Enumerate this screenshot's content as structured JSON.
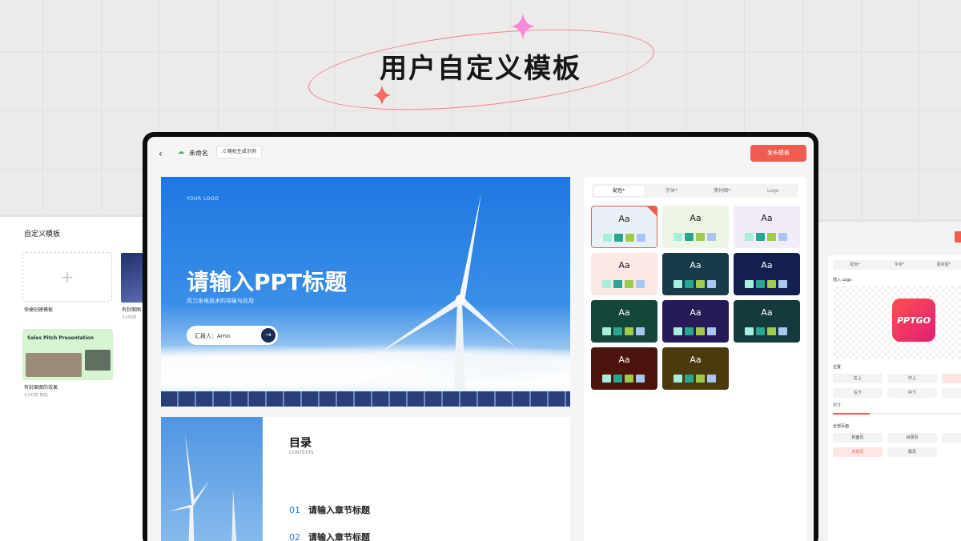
{
  "headline": "用户自定义模板",
  "left_panel": {
    "title": "自定义模板",
    "quick_card_label": "快捷创建模板",
    "dark_card_label": "有封面图",
    "dark_card_sub": "3小时前",
    "green_card_title": "Sales Pitch Presentation",
    "green_card_label": "有封面图的效果",
    "green_card_sub": "3小时前  精选"
  },
  "topbar": {
    "doc_title": "未命名",
    "random_button": "随机生成示例",
    "publish_button": "发布模板"
  },
  "slide1": {
    "logo": "YOUR LOGO",
    "title": "请输入PPT标题",
    "subtitle": "风力发电技术的突破与应用",
    "reporter": "汇报人：Arno"
  },
  "slide2": {
    "title": "目录",
    "contexts": "CONTEXTS",
    "chapters": [
      {
        "num": "01",
        "label": "请输入章节标题"
      },
      {
        "num": "02",
        "label": "请输入章节标题"
      }
    ]
  },
  "right_panel": {
    "tabs": [
      "配色*",
      "字体*",
      "素材图*",
      "Logo"
    ],
    "theme_label": "Aa",
    "themes": [
      {
        "bg": "#e8f1f5",
        "fg": "#222222",
        "selected": true
      },
      {
        "bg": "#ecf5e6",
        "fg": "#222222"
      },
      {
        "bg": "#f1ecf8",
        "fg": "#222222"
      },
      {
        "bg": "#fbe7e5",
        "fg": "#222222"
      },
      {
        "bg": "#173b4a",
        "fg": "#ffffff"
      },
      {
        "bg": "#13204f",
        "fg": "#ffffff"
      },
      {
        "bg": "#14463a",
        "fg": "#ffffff"
      },
      {
        "bg": "#261a57",
        "fg": "#ffffff"
      },
      {
        "bg": "#143a3e",
        "fg": "#ffffff"
      },
      {
        "bg": "#4b140c",
        "fg": "#ffffff"
      },
      {
        "bg": "#4b3a0d",
        "fg": "#ffffff"
      }
    ],
    "swatches": [
      "#a8eedc",
      "#2aa58f",
      "#9fca4a",
      "#a9c6f0"
    ]
  },
  "side_right": {
    "tabs": [
      "配色*",
      "字体*",
      "素材图*"
    ],
    "insert_logo": "插入 Logo",
    "logo_text": "PPTGO",
    "position_label": "位置",
    "positions": [
      "左上",
      "中上",
      "左下",
      "中下"
    ],
    "size_label": "尺寸",
    "pages_label": "全部页面",
    "pages": [
      "封面页",
      "目录页",
      "内容页",
      "尾页"
    ]
  },
  "colors": {
    "accent": "#f05b4f",
    "brand_blue": "#1e78e0"
  }
}
